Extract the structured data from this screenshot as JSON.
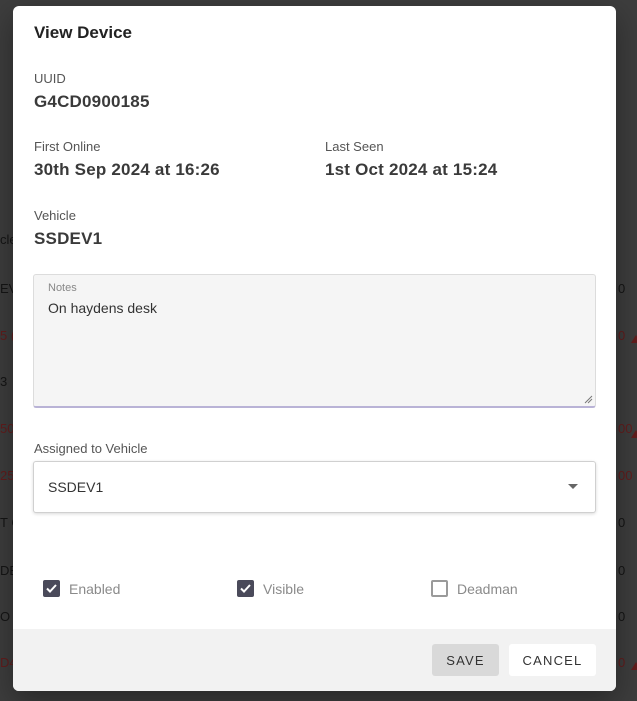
{
  "background": {
    "fragments_left": [
      "cle",
      "EV",
      "5 (",
      "3",
      "50",
      "25",
      "T C",
      "DE",
      "O",
      "D4"
    ],
    "fragments_right": [
      "0",
      "0",
      "0",
      "00",
      "00",
      "0",
      "0",
      "0",
      "0"
    ]
  },
  "modal": {
    "title": "View Device",
    "uuid": {
      "label": "UUID",
      "value": "G4CD0900185"
    },
    "first_online": {
      "label": "First Online",
      "value": "30th Sep 2024 at 16:26"
    },
    "last_seen": {
      "label": "Last Seen",
      "value": "1st Oct 2024 at 15:24"
    },
    "vehicle": {
      "label": "Vehicle",
      "value": "SSDEV1"
    },
    "notes": {
      "label": "Notes",
      "value": "On haydens desk"
    },
    "assigned_vehicle": {
      "label": "Assigned to Vehicle",
      "value": "SSDEV1"
    },
    "checkboxes": [
      {
        "label": "Enabled",
        "checked": true
      },
      {
        "label": "Visible",
        "checked": true
      },
      {
        "label": "Deadman",
        "checked": false
      }
    ],
    "buttons": {
      "save": "SAVE",
      "cancel": "CANCEL"
    }
  },
  "colors": {
    "overlay": "#000000",
    "checkbox_checked": "#4a4a5a",
    "accent_underline": "#b9b3d6"
  }
}
